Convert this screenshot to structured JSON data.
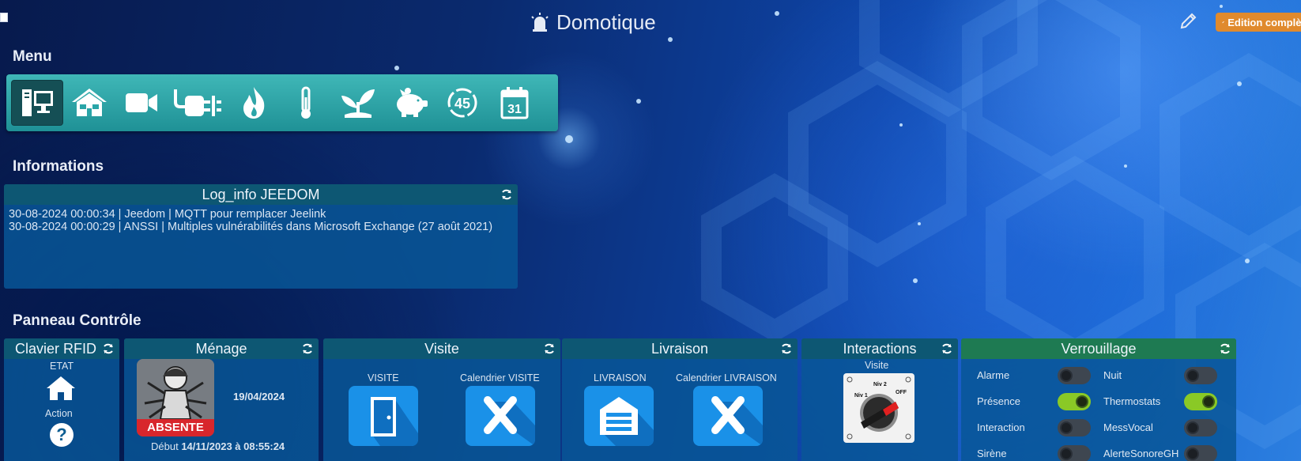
{
  "header": {
    "title": "Domotique",
    "edit_label": "Edition complète"
  },
  "sections": {
    "menu": "Menu",
    "informations": "Informations",
    "panneau": "Panneau Contrôle"
  },
  "menu": {
    "items": [
      {
        "icon": "computer-icon",
        "active": true
      },
      {
        "icon": "house-icon"
      },
      {
        "icon": "camera-icon"
      },
      {
        "icon": "plug-icon"
      },
      {
        "icon": "flame-icon"
      },
      {
        "icon": "thermometer-icon"
      },
      {
        "icon": "plant-icon"
      },
      {
        "icon": "piggy-bank-icon"
      },
      {
        "icon": "timer-45-icon",
        "text": "45"
      },
      {
        "icon": "calendar-icon",
        "text": "31"
      }
    ]
  },
  "log": {
    "title": "Log_info JEEDOM",
    "lines": [
      "30-08-2024 00:00:34 | Jeedom | MQTT pour remplacer Jeelink",
      "30-08-2024 00:00:29 | ANSSI | Multiples vulnérabilités dans Microsoft Exchange (27 août 2021)"
    ]
  },
  "panels": {
    "clavier": {
      "title": "Clavier RFID",
      "etat": "ETAT",
      "action": "Action"
    },
    "menage": {
      "title": "Ménage",
      "date": "19/04/2024",
      "status": "ABSENTE",
      "debut_label": "Début",
      "debut_value": "14/11/2023 à 08:55:24"
    },
    "visite": {
      "title": "Visite",
      "col1": "VISITE",
      "col2": "Calendrier VISITE"
    },
    "livraison": {
      "title": "Livraison",
      "col1": "LIVRAISON",
      "col2": "Calendrier LIVRAISON"
    },
    "interactions": {
      "title": "Interactions",
      "label": "Visite",
      "switch_labels": [
        "Niv 1",
        "Niv 2",
        "OFF"
      ]
    },
    "verrouillage": {
      "title": "Verrouillage",
      "rows": [
        {
          "left": "Alarme",
          "left_on": false,
          "right": "Nuit",
          "right_on": false
        },
        {
          "left": "Présence",
          "left_on": true,
          "right": "Thermostats",
          "right_on": true
        },
        {
          "left": "Interaction",
          "left_on": false,
          "right": "MessVocal",
          "right_on": false
        },
        {
          "left": "Sirène",
          "left_on": false,
          "right": "AlerteSonoreGH",
          "right_on": false
        }
      ]
    }
  },
  "colors": {
    "menu_bar": "#2aa5a8",
    "panel_head": "#0d5773",
    "verrouillage_head": "#1e7a52",
    "toggle_on": "#8ac926",
    "edit_button": "#e08a2d"
  }
}
